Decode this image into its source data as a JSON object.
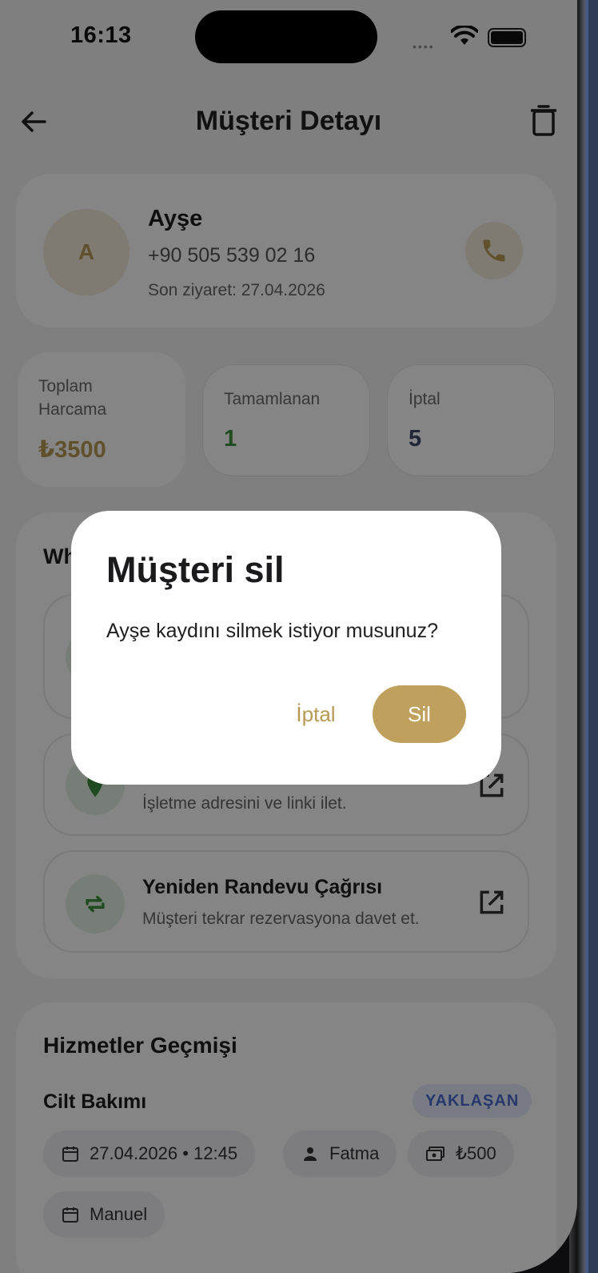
{
  "status_bar": {
    "time": "16:13"
  },
  "header": {
    "title": "Müşteri Detayı"
  },
  "customer": {
    "initial": "A",
    "name": "Ayşe",
    "phone": "+90 505 539 02 16",
    "last_visit": "Son ziyaret: 27.04.2026"
  },
  "stats": [
    {
      "label": "Toplam Harcama",
      "value": "₺3500"
    },
    {
      "label": "Tamamlanan",
      "value": "1"
    },
    {
      "label": "İptal",
      "value": "5"
    }
  ],
  "whatsapp": {
    "title": "Wh",
    "actions": [
      {
        "title": "",
        "desc": ""
      },
      {
        "title": "",
        "desc": "İşletme adresini ve linki ilet."
      },
      {
        "title": "Yeniden Randevu Çağrısı",
        "desc": "Müşteri tekrar rezervasyona davet et."
      }
    ]
  },
  "history": {
    "title": "Hizmetler Geçmişi",
    "service": "Cilt Bakımı",
    "badge": "YAKLAŞAN",
    "chips": {
      "datetime": "27.04.2026 • 12:45",
      "staff": "Fatma",
      "price": "₺500",
      "source": "Manuel"
    }
  },
  "dialog": {
    "title": "Müşteri sil",
    "message": "Ayşe kaydını silmek istiyor musunuz?",
    "cancel": "İptal",
    "confirm": "Sil"
  },
  "colors": {
    "accent": "#bfa05c",
    "completed": "#3f8f3f",
    "cancelled": "#3e4a6b",
    "badge_text": "#4a6ad0"
  }
}
